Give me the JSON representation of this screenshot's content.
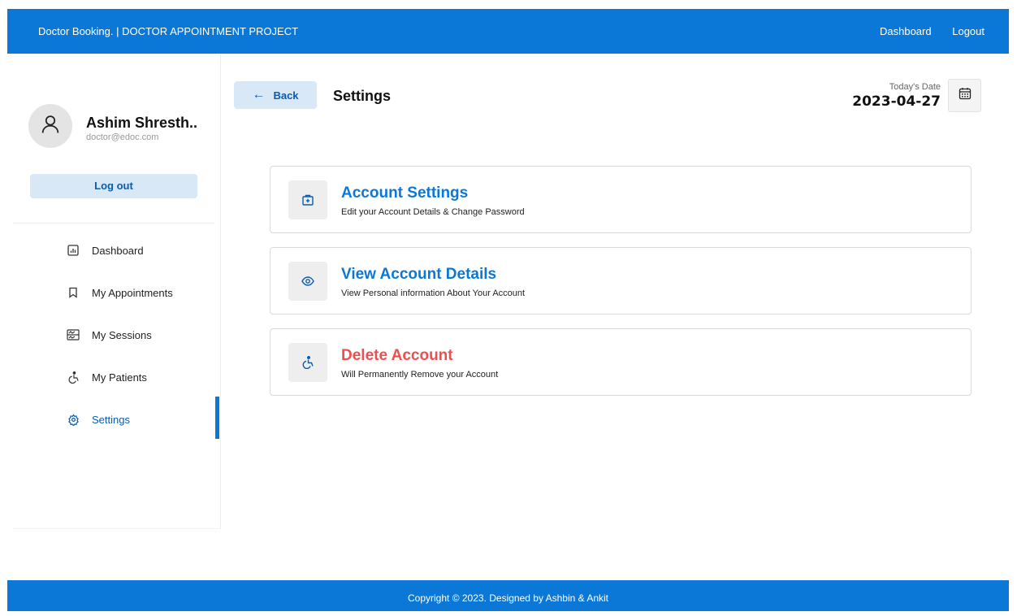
{
  "header": {
    "brand": "Doctor Booking. | DOCTOR APPOINTMENT PROJECT",
    "nav": [
      "Dashboard",
      "Logout"
    ]
  },
  "sidebar": {
    "user": {
      "name": "Ashim Shresth..",
      "email": "doctor@edoc.com"
    },
    "logout_label": "Log out",
    "items": [
      {
        "label": "Dashboard",
        "icon": "dashboard-icon"
      },
      {
        "label": "My Appointments",
        "icon": "bookmark-icon"
      },
      {
        "label": "My Sessions",
        "icon": "schedule-icon"
      },
      {
        "label": "My Patients",
        "icon": "wheelchair-icon"
      },
      {
        "label": "Settings",
        "icon": "gear-icon",
        "active": true
      }
    ]
  },
  "main": {
    "back_label": "Back",
    "title": "Settings",
    "date_label": "Today's Date",
    "date_value": "2023-04-27",
    "cards": [
      {
        "title": "Account Settings",
        "subtitle": "Edit your Account Details & Change Password",
        "icon": "medical-case-icon"
      },
      {
        "title": "View Account Details",
        "subtitle": "View Personal information About Your Account",
        "icon": "eye-icon"
      },
      {
        "title": "Delete Account",
        "subtitle": "Will Permanently Remove your Account",
        "icon": "wheelchair-icon"
      }
    ]
  },
  "footer": {
    "text": "Copyright © 2023. Designed by Ashbin & Ankit"
  },
  "colors": {
    "primary": "#0b78d8",
    "light_primary": "#d8e8f7",
    "danger": "#ef4e4e"
  }
}
